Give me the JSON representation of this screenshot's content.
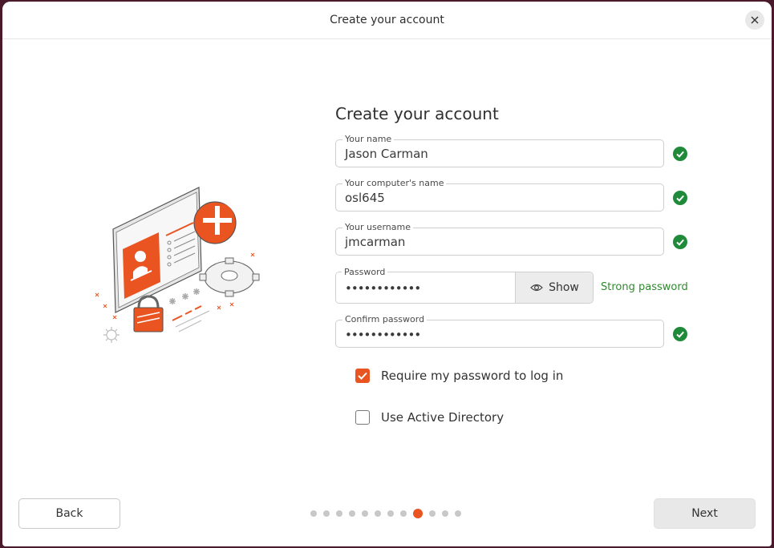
{
  "window": {
    "title": "Create your account"
  },
  "heading": "Create your account",
  "fields": {
    "name": {
      "label": "Your name",
      "value": "Jason Carman"
    },
    "computer": {
      "label": "Your computer's name",
      "value": "osl645"
    },
    "username": {
      "label": "Your username",
      "value": "jmcarman"
    },
    "password": {
      "label": "Password",
      "value": "••••••••••••",
      "show_label": "Show",
      "strength": "Strong password"
    },
    "confirm": {
      "label": "Confirm password",
      "value": "••••••••••••"
    }
  },
  "options": {
    "require_password": {
      "label": "Require my password to log in",
      "checked": true
    },
    "active_directory": {
      "label": "Use Active Directory",
      "checked": false
    }
  },
  "footer": {
    "back_label": "Back",
    "next_label": "Next",
    "pages_total": 12,
    "pages_current": 9
  },
  "colors": {
    "accent": "#e95420",
    "success": "#2e8b2e"
  },
  "icons": {
    "close": "close-icon",
    "valid": "check-circle-icon",
    "show": "eye-icon",
    "checkbox": "checkmark-icon"
  }
}
